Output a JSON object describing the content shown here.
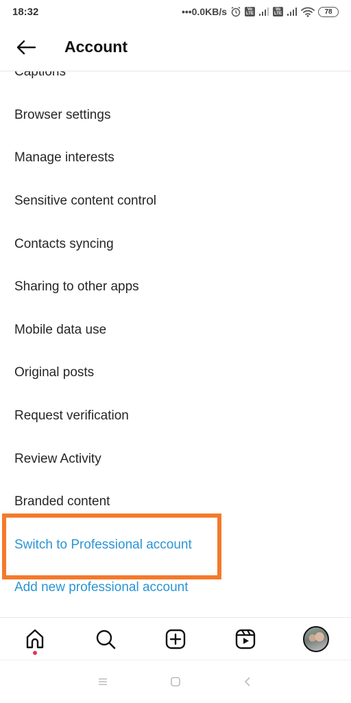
{
  "status_bar": {
    "time": "18:32",
    "network_speed": "•••0.0KB/s",
    "volte_label_1": "Vo",
    "volte_label_2": "LTE",
    "battery": "78"
  },
  "header": {
    "title": "Account"
  },
  "settings_list": {
    "items": [
      {
        "label": "Captions",
        "style": "normal"
      },
      {
        "label": "Browser settings",
        "style": "normal"
      },
      {
        "label": "Manage interests",
        "style": "normal"
      },
      {
        "label": "Sensitive content control",
        "style": "normal"
      },
      {
        "label": "Contacts syncing",
        "style": "normal"
      },
      {
        "label": "Sharing to other apps",
        "style": "normal"
      },
      {
        "label": "Mobile data use",
        "style": "normal"
      },
      {
        "label": "Original posts",
        "style": "normal"
      },
      {
        "label": "Request verification",
        "style": "normal"
      },
      {
        "label": "Review Activity",
        "style": "normal"
      },
      {
        "label": "Branded content",
        "style": "normal"
      },
      {
        "label": "Switch to Professional account",
        "style": "link"
      },
      {
        "label": "Add new professional account",
        "style": "link"
      }
    ]
  },
  "annotation": {
    "highlighted_item": "Switch to Professional account",
    "color": "#f47a2a"
  },
  "colors": {
    "link_blue": "#2a95d5",
    "text": "#262626",
    "notification_dot": "#e0384c"
  },
  "tab_bar": {
    "tabs": [
      {
        "icon": "home-icon",
        "has_notification": true
      },
      {
        "icon": "search-icon"
      },
      {
        "icon": "create-post-icon"
      },
      {
        "icon": "reels-icon"
      },
      {
        "icon": "profile-avatar"
      }
    ]
  },
  "system_nav": {
    "buttons": [
      "menu-icon",
      "home-square-icon",
      "back-chevron-icon"
    ]
  }
}
